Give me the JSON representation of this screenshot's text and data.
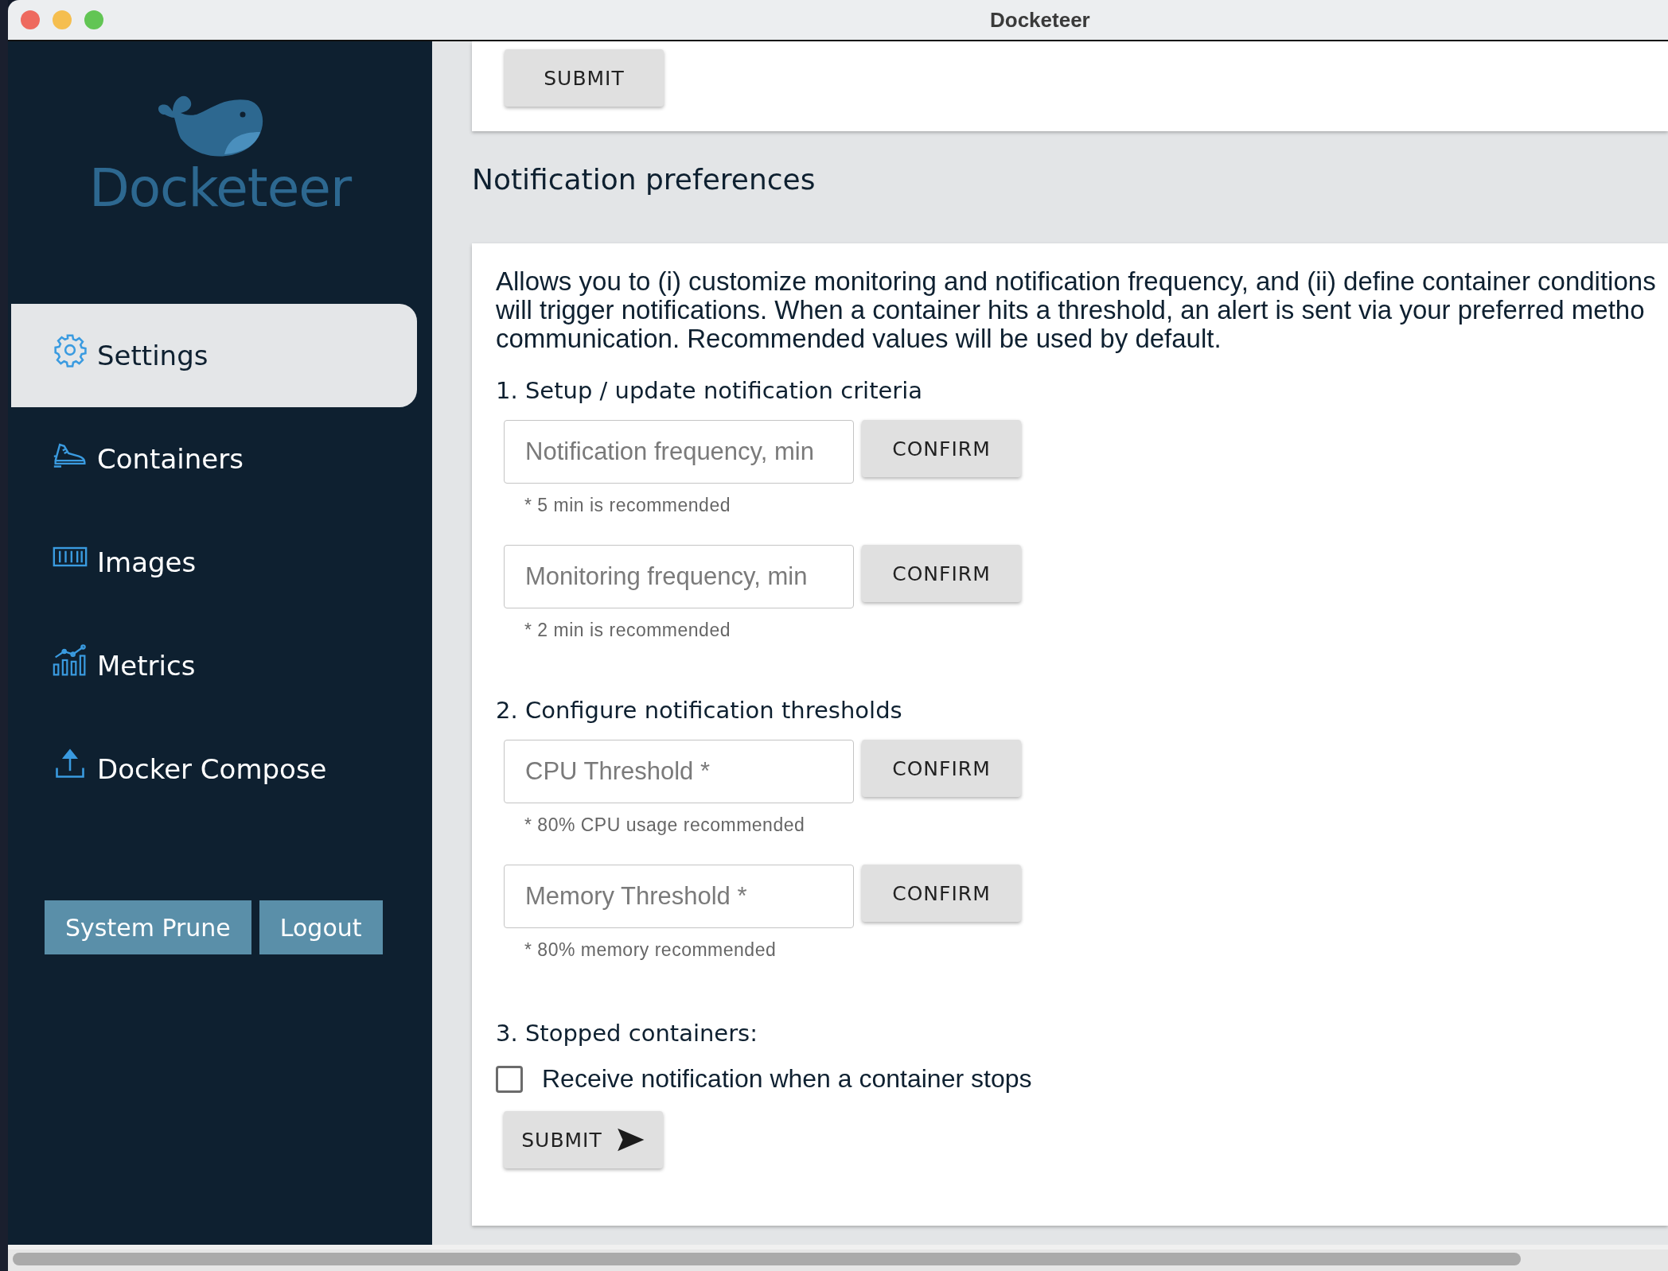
{
  "window": {
    "title": "Docketeer"
  },
  "sidebar": {
    "logo_text": "Docketeer",
    "items": [
      {
        "label": "Settings",
        "selected": true
      },
      {
        "label": "Containers",
        "selected": false
      },
      {
        "label": "Images",
        "selected": false
      },
      {
        "label": "Metrics",
        "selected": false
      },
      {
        "label": "Docker Compose",
        "selected": false
      }
    ],
    "buttons": [
      "System Prune",
      "Logout"
    ]
  },
  "top_card": {
    "button": "SUBMIT"
  },
  "section_title": "Notification preferences",
  "panel": {
    "description_lines": [
      "Allows you to (i) customize monitoring and notification frequency, and (ii) define container conditions",
      "will trigger notifications. When a container hits a threshold, an alert is sent via your preferred metho",
      "communication. Recommended values will be used by default."
    ],
    "sections": [
      {
        "heading": "1. Setup / update notification criteria",
        "fields": [
          {
            "placeholder": "Notification frequency, min",
            "button": "CONFIRM",
            "hint": "* 5 min is recommended"
          },
          {
            "placeholder": "Monitoring frequency, min",
            "button": "CONFIRM",
            "hint": "* 2 min is recommended"
          }
        ]
      },
      {
        "heading": "2. Configure notification thresholds",
        "fields": [
          {
            "placeholder": "CPU Threshold *",
            "button": "CONFIRM",
            "hint": "* 80% CPU usage recommended"
          },
          {
            "placeholder": "Memory Threshold *",
            "button": "CONFIRM",
            "hint": "* 80% memory recommended"
          }
        ]
      }
    ],
    "stopped": {
      "heading": "3. Stopped containers:",
      "checkbox": {
        "label": "Receive notification when a container stops",
        "checked": false
      }
    },
    "submit": "SUBMIT"
  }
}
